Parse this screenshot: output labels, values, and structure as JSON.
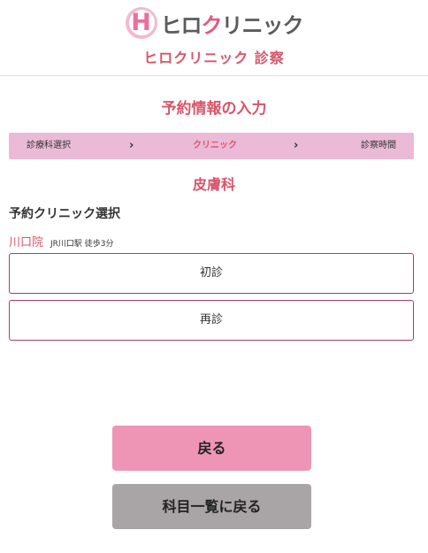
{
  "header": {
    "logo_letter": "H",
    "logo_text_a": "ヒロ",
    "logo_text_b": "ク",
    "logo_text_c": "リニック",
    "clinic_title": "ヒロクリニック 診察"
  },
  "main": {
    "section_title": "予約情報の入力",
    "steps": [
      {
        "label": "診療科選択"
      },
      {
        "label": "クリニック"
      },
      {
        "label": "診察時間"
      }
    ],
    "department": "皮膚科",
    "select_label": "予約クリニック選択",
    "location": {
      "name": "川口院",
      "access": "JR川口駅 徒歩3分"
    },
    "options": [
      {
        "label": "初診"
      },
      {
        "label": "再診"
      }
    ]
  },
  "footer": {
    "back_label": "戻る",
    "list_label": "科目一覧に戻る"
  },
  "colors": {
    "accent": "#d9556a",
    "step_bar": "#ebbad6",
    "back_button": "#ee95b5",
    "list_button": "#a9a4a6",
    "option_border": "#a63d6c"
  }
}
